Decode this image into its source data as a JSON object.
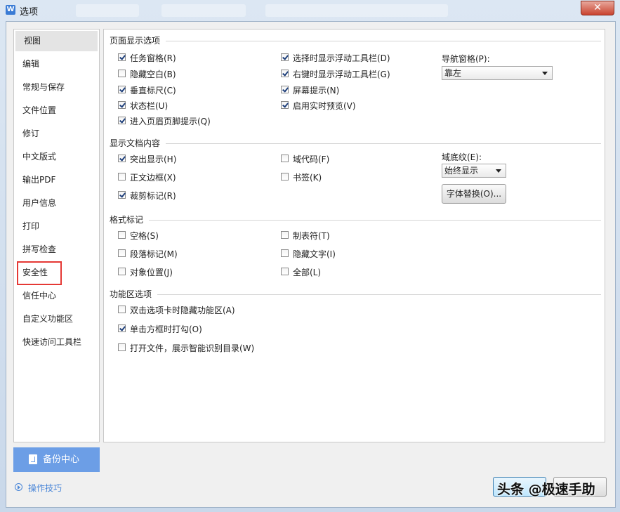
{
  "window": {
    "title": "选项",
    "app_icon_letter": "W",
    "close_symbol": "✕"
  },
  "sidebar": {
    "items": [
      {
        "label": "视图"
      },
      {
        "label": "编辑"
      },
      {
        "label": "常规与保存"
      },
      {
        "label": "文件位置"
      },
      {
        "label": "修订"
      },
      {
        "label": "中文版式"
      },
      {
        "label": "输出PDF"
      },
      {
        "label": "用户信息"
      },
      {
        "label": "打印"
      },
      {
        "label": "拼写检查"
      },
      {
        "label": "安全性"
      },
      {
        "label": "信任中心"
      },
      {
        "label": "自定义功能区"
      },
      {
        "label": "快速访问工具栏"
      }
    ],
    "active_index": 0,
    "highlighted_item": "安全性"
  },
  "backup": {
    "label": "备份中心"
  },
  "tips": {
    "label": "操作技巧"
  },
  "sections": {
    "page_display": {
      "title": "页面显示选项",
      "options": [
        {
          "label": "任务窗格(R)",
          "checked": true
        },
        {
          "label": "隐藏空白(B)",
          "checked": false
        },
        {
          "label": "垂直标尺(C)",
          "checked": true
        },
        {
          "label": "状态栏(U)",
          "checked": true
        },
        {
          "label": "进入页眉页脚提示(Q)",
          "checked": true
        },
        {
          "label": "选择时显示浮动工具栏(D)",
          "checked": true
        },
        {
          "label": "右键时显示浮动工具栏(G)",
          "checked": true
        },
        {
          "label": "屏幕提示(N)",
          "checked": true
        },
        {
          "label": "启用实时预览(V)",
          "checked": true
        }
      ],
      "nav_pane_label": "导航窗格(P):",
      "nav_pane_value": "靠左"
    },
    "doc_content": {
      "title": "显示文档内容",
      "options": [
        {
          "label": "突出显示(H)",
          "checked": true
        },
        {
          "label": "正文边框(X)",
          "checked": false
        },
        {
          "label": "裁剪标记(R)",
          "checked": true
        },
        {
          "label": "域代码(F)",
          "checked": false
        },
        {
          "label": "书签(K)",
          "checked": false
        }
      ],
      "shading_label": "域底纹(E):",
      "shading_value": "始终显示",
      "font_sub_button": "字体替换(O)..."
    },
    "format_marks": {
      "title": "格式标记",
      "options": [
        {
          "label": "空格(S)",
          "checked": false
        },
        {
          "label": "段落标记(M)",
          "checked": false
        },
        {
          "label": "对象位置(J)",
          "checked": false
        },
        {
          "label": "制表符(T)",
          "checked": false
        },
        {
          "label": "隐藏文字(I)",
          "checked": false
        },
        {
          "label": "全部(L)",
          "checked": false
        }
      ]
    },
    "ribbon": {
      "title": "功能区选项",
      "options": [
        {
          "label": "双击选项卡时隐藏功能区(A)",
          "checked": false
        },
        {
          "label": "单击方框时打勾(O)",
          "checked": true
        },
        {
          "label": "打开文件，展示智能识别目录(W)",
          "checked": false
        }
      ]
    }
  },
  "watermark": {
    "text": "头条 @极速手助"
  }
}
